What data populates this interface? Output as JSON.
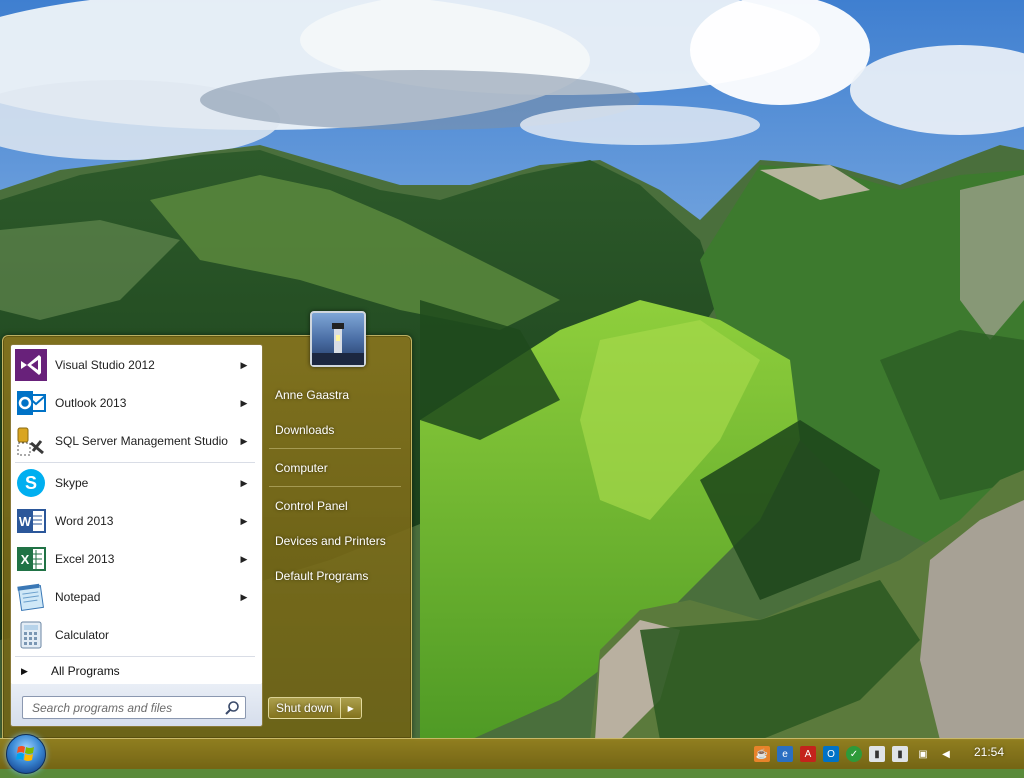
{
  "start_menu": {
    "programs": [
      {
        "label": "Visual Studio 2012",
        "icon": "visual-studio-icon",
        "has_submenu": true
      },
      {
        "label": "Outlook 2013",
        "icon": "outlook-icon",
        "has_submenu": true
      },
      {
        "label": "SQL Server Management Studio",
        "icon": "sql-server-icon",
        "has_submenu": true
      },
      {
        "label": "Skype",
        "icon": "skype-icon",
        "has_submenu": true
      },
      {
        "label": "Word 2013",
        "icon": "word-icon",
        "has_submenu": true
      },
      {
        "label": "Excel 2013",
        "icon": "excel-icon",
        "has_submenu": true
      },
      {
        "label": "Notepad",
        "icon": "notepad-icon",
        "has_submenu": true
      },
      {
        "label": "Calculator",
        "icon": "calculator-icon",
        "has_submenu": false
      }
    ],
    "all_programs_label": "All Programs",
    "search_placeholder": "Search programs and files",
    "right_links": [
      {
        "label": "Anne Gaastra"
      },
      {
        "label": "Downloads"
      },
      {
        "label": "Computer"
      },
      {
        "label": "Control Panel"
      },
      {
        "label": "Devices and Printers"
      },
      {
        "label": "Default Programs"
      }
    ],
    "shutdown_label": "Shut down"
  },
  "taskbar": {
    "clock": "21:54",
    "tray_icons": [
      "java-icon",
      "network-share-icon",
      "acrobat-icon",
      "outlook-tray-icon",
      "security-shield-icon",
      "usb-device-icon",
      "usb-device-icon",
      "network-icon",
      "volume-icon"
    ]
  },
  "colors": {
    "glass_accent": "#8c761e",
    "menu_text": "#1e1e1e"
  }
}
